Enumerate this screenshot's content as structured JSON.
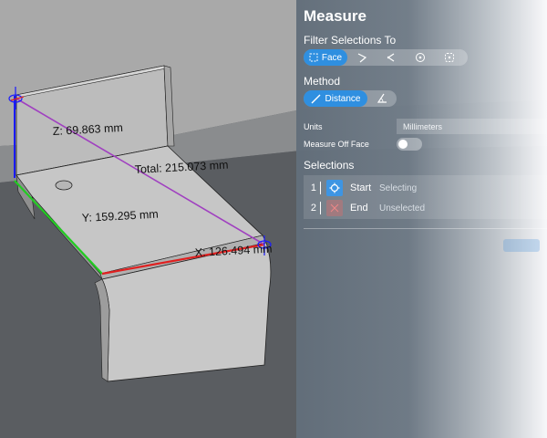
{
  "panel": {
    "title": "Measure",
    "filter_label": "Filter Selections To",
    "filter_options": [
      {
        "label": "Face",
        "icon": "face-icon",
        "active": true
      },
      {
        "label": "",
        "icon": "edge-icon",
        "active": false
      },
      {
        "label": "",
        "icon": "vertex-icon",
        "active": false
      },
      {
        "label": "",
        "icon": "point-icon",
        "active": false
      },
      {
        "label": "",
        "icon": "center-icon",
        "active": false
      }
    ],
    "method_label": "Method",
    "methods": [
      {
        "label": "Distance",
        "icon": "ruler-icon",
        "active": true
      },
      {
        "label": "",
        "icon": "angle-icon",
        "active": false
      }
    ],
    "units_label": "Units",
    "units_value": "Millimeters",
    "measure_off_face_label": "Measure Off Face",
    "measure_off_face_on": false,
    "selections_label": "Selections",
    "selections": [
      {
        "num": "1",
        "label": "Start",
        "state": "Selecting",
        "icon": "crosshair-icon"
      },
      {
        "num": "2",
        "label": "End",
        "state": "Unselected",
        "icon": "close-icon"
      }
    ]
  },
  "viewport": {
    "z_label": "Z: 69.863 mm",
    "total_label": "Total: 215.073 mm",
    "y_label": "Y: 159.295 mm",
    "x_label": "X: 126.494 mm"
  },
  "colors": {
    "accent": "#2f8fe0",
    "x_axis": "#e02020",
    "y_axis": "#22cc22",
    "z_axis": "#1a1aff",
    "total_line": "#a040c0"
  }
}
